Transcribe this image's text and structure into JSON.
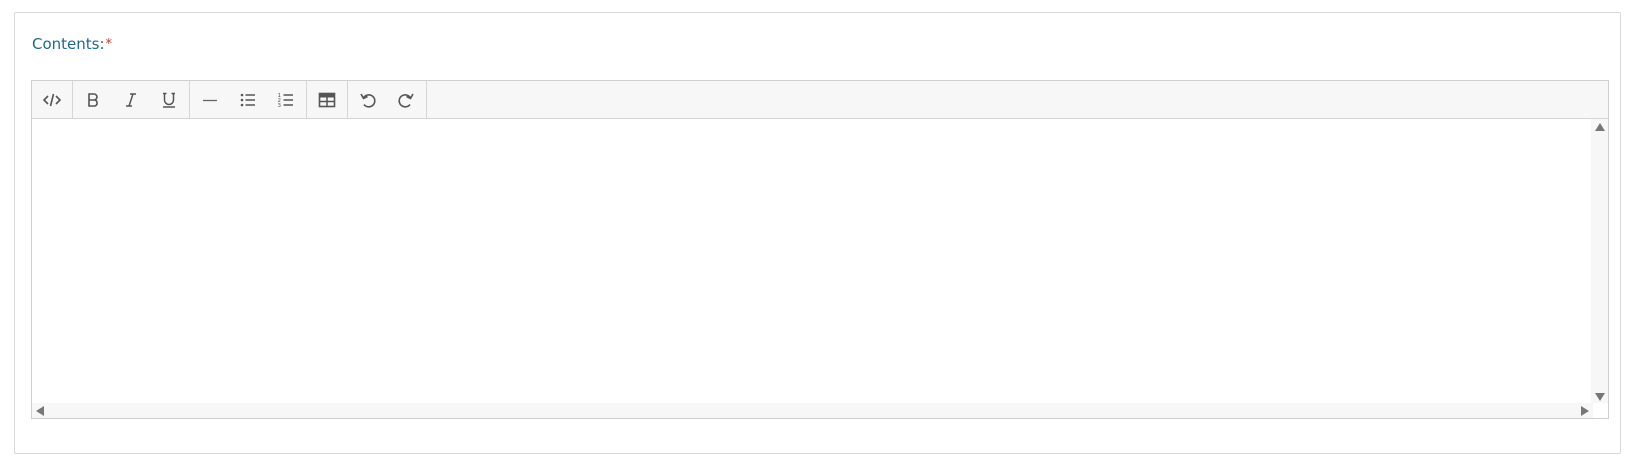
{
  "form": {
    "field_label": "Contents:",
    "required_marker": "*"
  },
  "editor": {
    "content": "",
    "toolbar": [
      {
        "group": "code",
        "buttons": [
          {
            "icon": "code-view-icon"
          }
        ]
      },
      {
        "group": "format",
        "buttons": [
          {
            "icon": "bold-icon"
          },
          {
            "icon": "italic-icon"
          },
          {
            "icon": "underline-icon"
          }
        ]
      },
      {
        "group": "insert",
        "buttons": [
          {
            "icon": "horizontal-rule-icon"
          },
          {
            "icon": "unordered-list-icon"
          },
          {
            "icon": "ordered-list-icon"
          }
        ]
      },
      {
        "group": "table",
        "buttons": [
          {
            "icon": "table-icon"
          }
        ]
      },
      {
        "group": "history",
        "buttons": [
          {
            "icon": "undo-icon"
          },
          {
            "icon": "redo-icon"
          }
        ]
      }
    ]
  },
  "colors": {
    "label": "#1f6a89",
    "required": "#c0392b",
    "toolbar_bg": "#f7f7f7",
    "icon": "#555555"
  }
}
